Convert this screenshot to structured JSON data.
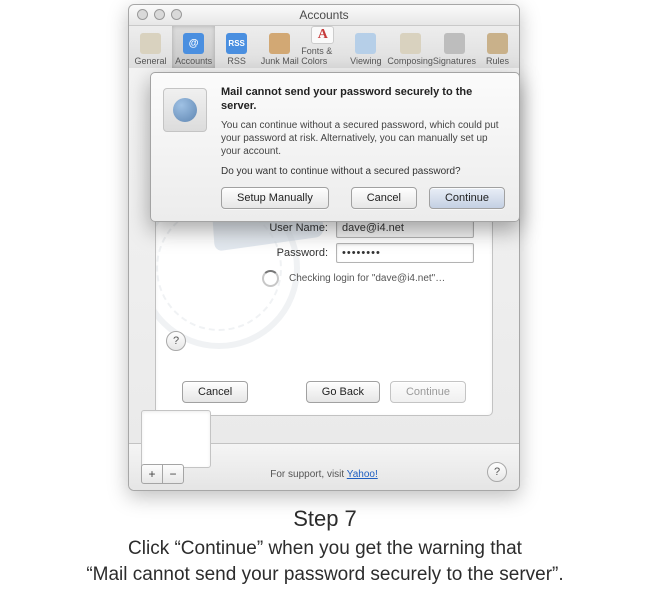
{
  "window": {
    "title": "Accounts",
    "toolbar": [
      {
        "label": "General",
        "icon": "switch-icon",
        "color": "#d9d2bf"
      },
      {
        "label": "Accounts",
        "icon": "at-icon",
        "color": "#4a8fe0",
        "selected": true
      },
      {
        "label": "RSS",
        "icon": "rss-icon",
        "color": "#4a8fe0"
      },
      {
        "label": "Junk Mail",
        "icon": "trash-icon",
        "color": "#d2a874"
      },
      {
        "label": "Fonts & Colors",
        "icon": "font-icon",
        "color": "#e0e0e0"
      },
      {
        "label": "Viewing",
        "icon": "eye-icon",
        "color": "#b6cfe8"
      },
      {
        "label": "Composing",
        "icon": "pencil-icon",
        "color": "#d9d2bf"
      },
      {
        "label": "Signatures",
        "icon": "pen-icon",
        "color": "#bdbdbd"
      },
      {
        "label": "Rules",
        "icon": "ruler-icon",
        "color": "#c9b18a"
      }
    ]
  },
  "sheet": {
    "username_label": "User Name:",
    "username_value": "dave@i4.net",
    "password_label": "Password:",
    "password_value": "••••••••",
    "status": "Checking login for \"dave@i4.net\"…",
    "cancel": "Cancel",
    "goback": "Go Back",
    "continue": "Continue",
    "help_glyph": "?"
  },
  "footer": {
    "add": "+",
    "remove": "−",
    "support_prefix": "For support, visit ",
    "support_link": "Yahoo!",
    "help_glyph": "?"
  },
  "alert": {
    "title": "Mail cannot send your password securely to the server.",
    "body": "You can continue without a secured password, which could put your password at risk. Alternatively, you can manually set up your account.",
    "question": "Do you want to continue without a secured password?",
    "setup": "Setup Manually",
    "cancel": "Cancel",
    "continue": "Continue"
  },
  "caption": {
    "heading": "Step 7",
    "line1": "Click “Continue” when you get the warning that",
    "line2": "“Mail cannot send your password securely to the server”."
  },
  "toolbar_glyph": {
    "at-icon": "@",
    "rss-icon": "RSS",
    "font-icon": "A",
    "trash-icon": "",
    "switch-icon": "",
    "eye-icon": "",
    "pencil-icon": "",
    "pen-icon": "",
    "ruler-icon": ""
  }
}
